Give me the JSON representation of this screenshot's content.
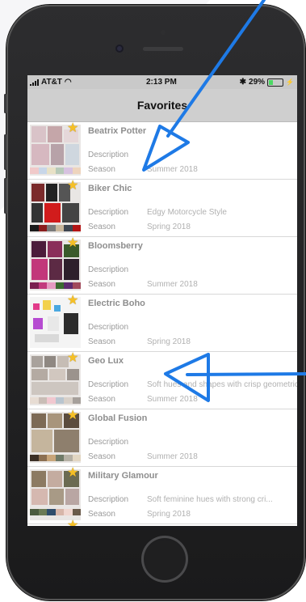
{
  "status_bar": {
    "carrier": "AT&T",
    "time": "2:13 PM",
    "battery": "29%",
    "battery_level": 0.29
  },
  "nav": {
    "title": "Favorites"
  },
  "labels": {
    "description": "Description",
    "season": "Season"
  },
  "items": [
    {
      "title": "Beatrix Potter",
      "description": "",
      "season": "Summer 2018"
    },
    {
      "title": "Biker Chic",
      "description": "Edgy Motorcycle Style",
      "season": "Spring 2018"
    },
    {
      "title": "Bloomsberry",
      "description": "",
      "season": "Summer 2018"
    },
    {
      "title": "Electric Boho",
      "description": "",
      "season": "Spring 2018"
    },
    {
      "title": "Geo Lux",
      "description": "Soft hues and shapes with crisp geometric accents",
      "season": "Summer 2018"
    },
    {
      "title": "Global Fusion",
      "description": "",
      "season": "Summer 2018"
    },
    {
      "title": "Military Glamour",
      "description": "Soft feminine hues with strong cri...",
      "season": "Spring 2018"
    }
  ],
  "colors": {
    "arrow": "#1e7ae6",
    "star": "#f6c026",
    "nav_bg": "#cfcfcf"
  }
}
